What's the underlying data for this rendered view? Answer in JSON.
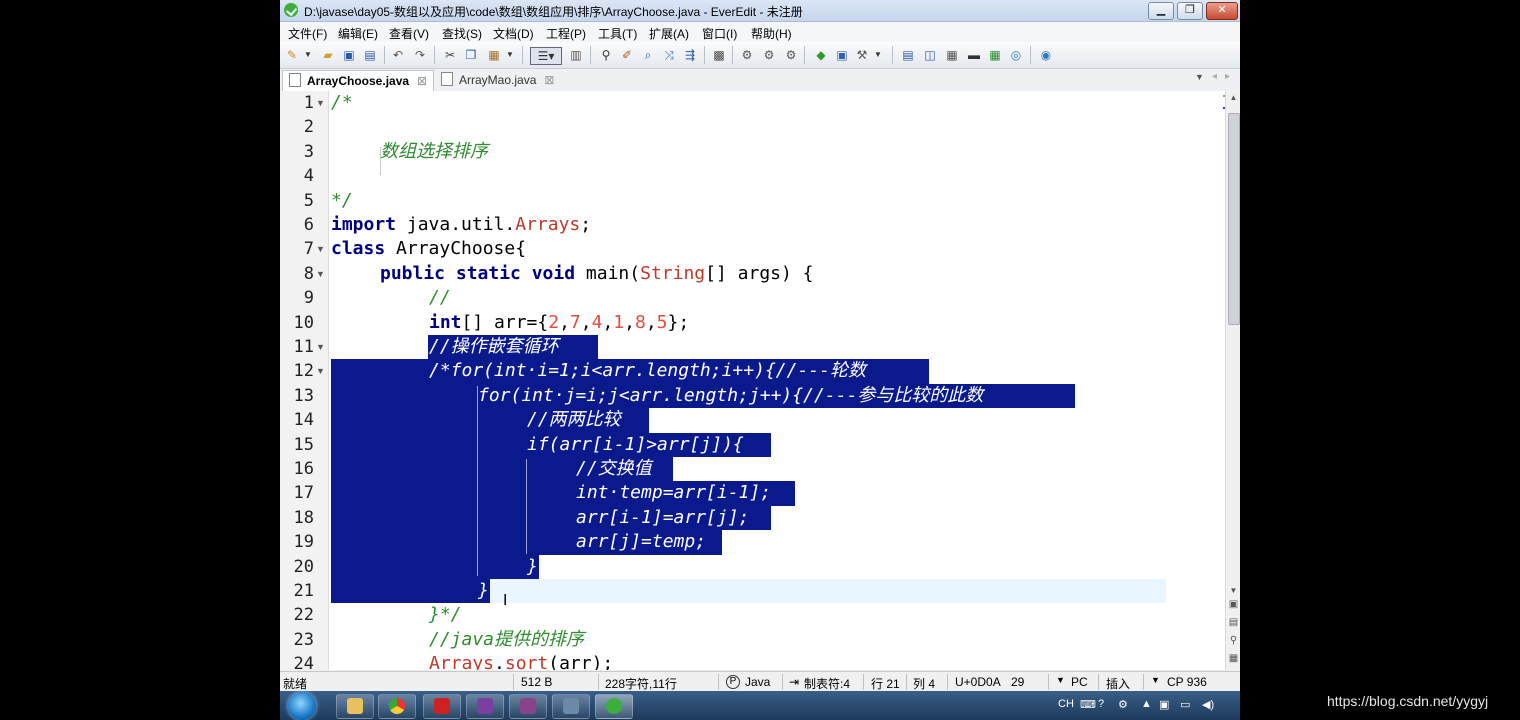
{
  "window": {
    "title": "D:\\javase\\day05-数组以及应用\\code\\数组\\数组应用\\排序\\ArrayChoose.java - EverEdit - 未注册",
    "minimize": "▁",
    "restore": "❐",
    "close": "✕"
  },
  "menu": [
    "文件(F)",
    "编辑(E)",
    "查看(V)",
    "查找(S)",
    "文档(D)",
    "工程(P)",
    "工具(T)",
    "扩展(A)",
    "窗口(I)",
    "帮助(H)"
  ],
  "tabs": [
    {
      "label": "ArrayChoose.java",
      "active": true
    },
    {
      "label": "ArrayMao.java",
      "active": false
    }
  ],
  "tab_close": "⊠",
  "line_numbers": [
    "1",
    "2",
    "3",
    "4",
    "5",
    "6",
    "7",
    "8",
    "9",
    "10",
    "11",
    "12",
    "13",
    "14",
    "15",
    "16",
    "17",
    "18",
    "19",
    "20",
    "21",
    "22",
    "23",
    "24"
  ],
  "code": {
    "l1": "/*",
    "l3": "数组选择排序",
    "l5": "*/",
    "l6_kw": "import",
    "l6_a": " java.util.",
    "l6_cls": "Arrays",
    "l6_b": ";",
    "l7_kw": "class",
    "l7_a": " ArrayChoose{",
    "l8_kw": "public static void",
    "l8_a": " main(",
    "l8_cls": "String",
    "l8_b": "[] args) {",
    "l9": "//",
    "l10_kw": "int",
    "l10_a": "[] arr={",
    "l10_nums": [
      "2",
      "7",
      "4",
      "1",
      "8",
      "5"
    ],
    "l10_b": "};",
    "l11": "//操作嵌套循环",
    "l12": "/*for(int·i=1;i<arr.length;i++){//---轮数",
    "l13": "for(int·j=i;j<arr.length;j++){//---参与比较的此数",
    "l14": "//两两比较",
    "l15": "if(arr[i-1]>arr[j]){",
    "l16": "//交换值",
    "l17": "int·temp=arr[i-1];",
    "l18": "arr[i-1]=arr[j];",
    "l19": "arr[j]=temp;",
    "l20": "}",
    "l21": "}",
    "l22": "}*/",
    "l23": "//java提供的排序",
    "l24_cls": "Arrays",
    "l24_a": ".",
    "l24_m": "sort",
    "l24_b": "(arr);"
  },
  "status": {
    "ready": "就绪",
    "size": "512 B",
    "chars": "228字符,11行",
    "lang": "Java",
    "tab": "制表符:4",
    "row": "行 21",
    "col": "列 4",
    "unicode": "U+0D0A",
    "code": "29",
    "eol": "PC",
    "mode": "插入",
    "encoding": "CP 936"
  },
  "tray": {
    "ime": "CH"
  },
  "watermark": "https://blog.csdn.net/yygyj"
}
